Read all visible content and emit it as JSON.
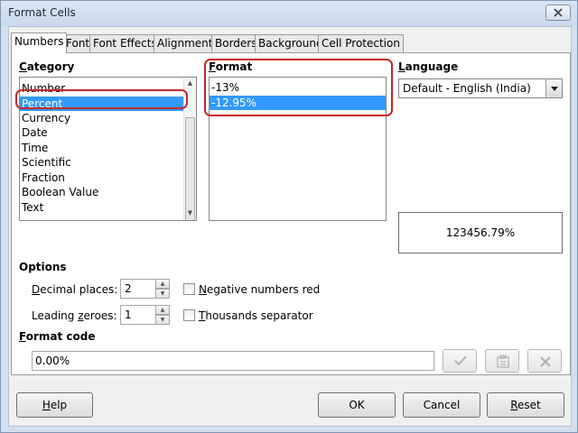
{
  "window": {
    "title": "Format Cells"
  },
  "tabs": [
    {
      "label": "Numbers"
    },
    {
      "label": "Font"
    },
    {
      "label": "Font Effects"
    },
    {
      "label": "Alignment"
    },
    {
      "label": "Borders"
    },
    {
      "label": "Background"
    },
    {
      "label": "Cell Protection"
    }
  ],
  "category": {
    "label_first": "C",
    "label_rest": "ategory",
    "items": [
      "Number",
      "Percent",
      "Currency",
      "Date",
      "Time",
      "Scientific",
      "Fraction",
      "Boolean Value",
      "Text"
    ],
    "selected": "Percent"
  },
  "format": {
    "label_first": "F",
    "label_rest": "ormat",
    "items": [
      "-13%",
      "-12.95%"
    ],
    "selected": "-12.95%"
  },
  "language": {
    "label_first": "L",
    "label_rest": "anguage",
    "value": "Default - English (India)"
  },
  "preview": {
    "value": "123456.79%"
  },
  "options": {
    "title": "Options",
    "decimal_first": "D",
    "decimal_rest": "ecimal places:",
    "decimal_value": "2",
    "leading_first": "Leading ",
    "leading_u": "z",
    "leading_rest": "eroes:",
    "leading_value": "1",
    "negative_first": "N",
    "negative_rest": "egative numbers red",
    "negative_checked": false,
    "thousands_first": "T",
    "thousands_rest": "housands separator",
    "thousands_checked": false
  },
  "format_code": {
    "label_first": "F",
    "label_rest": "ormat code",
    "value": "0.00%"
  },
  "buttons": {
    "help_first": "H",
    "help_rest": "elp",
    "ok": "OK",
    "cancel": "Cancel",
    "reset_first": "R",
    "reset_rest": "eset"
  },
  "colors": {
    "selection": "#3399ff",
    "highlight_outline": "#c62828"
  },
  "icons": {
    "close": "close-icon",
    "accept": "checkmark-icon",
    "comment": "comment-icon",
    "delete": "delete-x-icon",
    "dropdown": "chevron-down-icon"
  }
}
